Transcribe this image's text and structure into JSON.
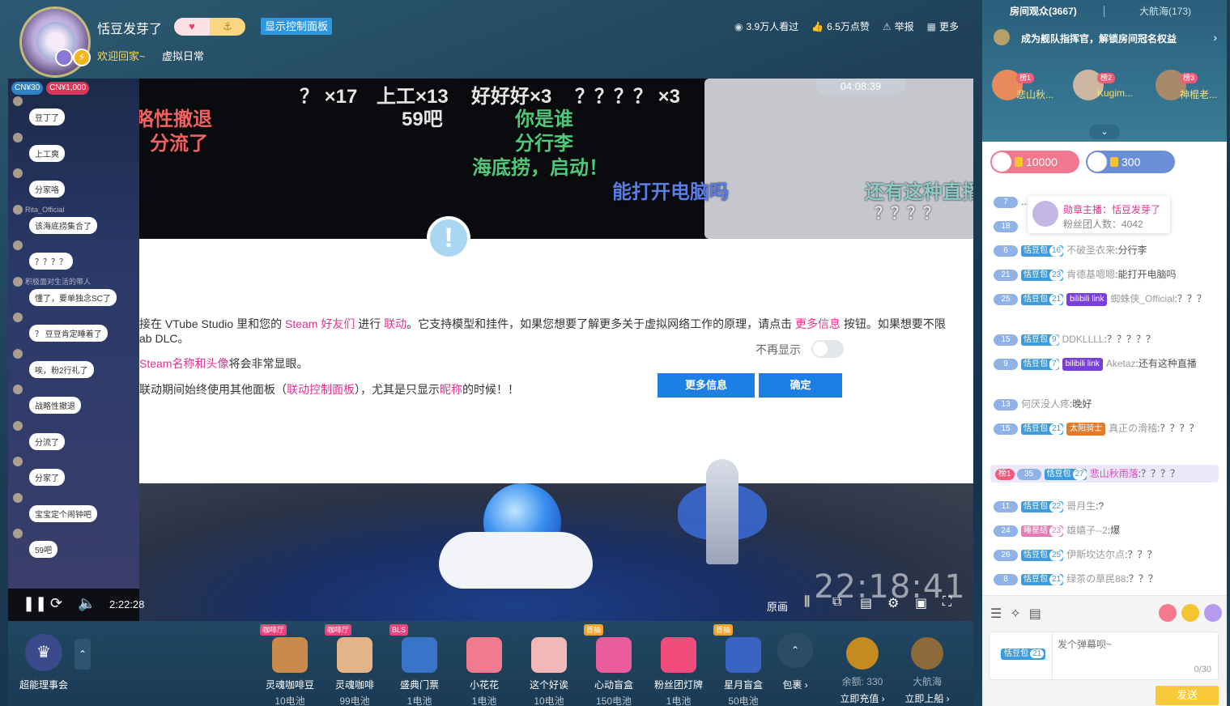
{
  "header": {
    "streamer_name": "恬豆发芽了",
    "control_panel_label": "显示控制面板",
    "welcome": "欢迎回家~",
    "area": "虚拟日常",
    "viewers": "3.9万人看过",
    "likes": "6.5万点赞",
    "report": "举报",
    "more": "更多"
  },
  "player": {
    "overlay_timer": "04:08:39",
    "danmaku": [
      {
        "text": "？ ×17",
        "color": "white"
      },
      {
        "text": "上工×13",
        "color": "white"
      },
      {
        "text": "好好好×3",
        "color": "white"
      },
      {
        "text": "？？？？ ×3",
        "color": "white"
      },
      {
        "text": "59吧",
        "color": "white"
      },
      {
        "text": "你是谁",
        "color": "green"
      },
      {
        "text": "战略性撤退",
        "color": "red"
      },
      {
        "text": "分流了",
        "color": "red"
      },
      {
        "text": "分行李",
        "color": "green"
      },
      {
        "text": "海底捞，启动！",
        "color": "green"
      },
      {
        "text": "能打开电脑吗",
        "color": "blue"
      },
      {
        "text": "还有这种直播",
        "color": "cyan"
      },
      {
        "text": "？？？？",
        "color": "white"
      }
    ],
    "dialog": {
      "p1_a": "接在 VTube Studio 里和您的 ",
      "p1_b": "Steam 好友们",
      "p1_c": " 进行 ",
      "p1_d": "联动",
      "p1_e": "。它支持模型和挂件，如果您想要了解更多关于虚拟网络工作的原理，请点击 ",
      "p1_f": "更多信息",
      "p1_g": " 按钮。如果想要不限",
      "p1_h": "ab DLC。",
      "p2_a": "Steam名称和头像",
      "p2_b": "将会非常显眼。",
      "p3_a": "联动期间始终使用其他面板（",
      "p3_b": "联动控制面板",
      "p3_c": "），尤其是只显示",
      "p3_d": "昵称",
      "p3_e": "的时候！！",
      "dont_show": "不再显示",
      "more_info": "更多信息",
      "confirm": "确定"
    },
    "stream_clock": "22:18:41",
    "play_time": "2:22:28",
    "quality": "原画",
    "in_chat": {
      "cn1": "CN¥30",
      "cn2": "CN¥1,000",
      "messages": [
        {
          "user": "",
          "text": "豆丁了"
        },
        {
          "user": "",
          "text": "上工爽"
        },
        {
          "user": "",
          "text": "分家咯"
        },
        {
          "user": "Rita_Official",
          "text": "该海底捞集合了"
        },
        {
          "user": "",
          "text": "？？？？"
        },
        {
          "user": "积极面对生活的带人",
          "text": "懂了，要单独念SC了"
        },
        {
          "user": "",
          "text": "？ 豆豆肯定睡着了"
        },
        {
          "user": "",
          "text": "唉，粉2行礼了"
        },
        {
          "user": "",
          "text": "战略性撤退"
        },
        {
          "user": "",
          "text": "分流了"
        },
        {
          "user": "",
          "text": "分家了"
        },
        {
          "user": "",
          "text": "宝宝定个闹钟吧"
        },
        {
          "user": "",
          "text": "59吧"
        }
      ]
    }
  },
  "giftbar": {
    "club_label": "超能理事会",
    "gifts": [
      {
        "tag": "咖啡厅",
        "name": "灵魂咖啡豆",
        "price": "10电池",
        "color": "#c98a4a"
      },
      {
        "tag": "咖啡厅",
        "name": "灵魂咖啡",
        "price": "99电池",
        "color": "#e2b487"
      },
      {
        "tag": "BLS",
        "name": "盛典门票",
        "price": "1电池",
        "color": "#3a74c9"
      },
      {
        "tag": "",
        "name": "小花花",
        "price": "1电池",
        "color": "#f07a8e"
      },
      {
        "tag": "",
        "name": "这个好诶",
        "price": "10电池",
        "color": "#f2b7b7"
      },
      {
        "tag": "首抽",
        "name": "心动盲盒",
        "price": "150电池",
        "color": "#e85d9a"
      },
      {
        "tag": "",
        "name": "粉丝团灯牌",
        "price": "1电池",
        "color": "#f04d7d"
      },
      {
        "tag": "首抽",
        "name": "星月盲盒",
        "price": "50电池",
        "color": "#3a64c4"
      }
    ],
    "package_label": "包裹",
    "balance_label": "余额: 330",
    "recharge_label": "立即充值",
    "voyage_label": "大航海",
    "board_label": "立即上船"
  },
  "sidebar": {
    "tab_viewers": "房间观众(3667)",
    "tab_voyage": "大航海(173)",
    "fleet_banner": "成为舰队指挥官，解锁房间冠名权益",
    "top_ranks": [
      {
        "rank": "榜1",
        "name": "悲山秋..."
      },
      {
        "rank": "榜2",
        "name": "Kugim..."
      },
      {
        "rank": "榜3",
        "name": "神棍老..."
      }
    ],
    "pill1_value": "10000",
    "pill2_value": "300",
    "anchor_card": {
      "title": "勋章主播：恬豆发芽了",
      "fans": "粉丝团人数：4042"
    },
    "messages": [
      {
        "lv": "7",
        "fan": "",
        "fan_lv": "",
        "medal": "",
        "user": "",
        "text": "...动!"
      },
      {
        "lv": "18",
        "fan": "",
        "fan_lv": "",
        "medal": "",
        "user": "",
        "text": ""
      },
      {
        "lv": "6",
        "fan": "恬豆包",
        "fan_lv": "16",
        "medal": "",
        "user": "不破圣衣来",
        "text": ":分行李"
      },
      {
        "lv": "21",
        "fan": "恬豆包",
        "fan_lv": "23",
        "medal": "",
        "user": "肯德基嗯嗯",
        "text": ":能打开电脑吗"
      },
      {
        "lv": "25",
        "fan": "恬豆包",
        "fan_lv": "21",
        "medal": "bilibili link",
        "user": "蜘蛛侠_Official",
        "text": ":？？？"
      },
      {
        "lv": "15",
        "fan": "恬豆包",
        "fan_lv": "9",
        "medal": "",
        "user": "DDKLLLL",
        "text": ":？？？？？"
      },
      {
        "lv": "9",
        "fan": "恬豆包",
        "fan_lv": "7",
        "medal": "bilibili link",
        "user": "Aketaz",
        "text": ":还有这种直播"
      },
      {
        "lv": "13",
        "fan": "",
        "fan_lv": "",
        "medal": "",
        "user": "何厌没人疼",
        "text": ":晚好"
      },
      {
        "lv": "15",
        "fan": "恬豆包",
        "fan_lv": "21",
        "medal": "太阳骑士",
        "user": "真正の滑稽",
        "text": ":？？？？"
      },
      {
        "lv": "35",
        "fan": "恬豆包",
        "fan_lv": "27",
        "medal": "",
        "user": "悲山秋雨落",
        "text": ":？？？？",
        "rank": "榜1"
      },
      {
        "lv": "11",
        "fan": "恬豆包",
        "fan_lv": "22",
        "medal": "",
        "user": "哥月生",
        "text": ":?"
      },
      {
        "lv": "24",
        "fan": "睡星结",
        "fan_lv": "23",
        "medal": "",
        "user": "雄嬉子--2",
        "text": ":爆"
      },
      {
        "lv": "26",
        "fan": "恬豆包",
        "fan_lv": "25",
        "medal": "",
        "user": "伊斯坎达尔点",
        "text": ":？？？"
      },
      {
        "lv": "8",
        "fan": "恬豆包",
        "fan_lv": "21",
        "medal": "",
        "user": "绿茶の草民88",
        "text": ":？？？"
      }
    ],
    "input": {
      "fan_badge": "恬豆包",
      "fan_badge_lv": "21",
      "placeholder": "发个弹幕呗~",
      "count": "0/30",
      "send": "发送"
    }
  }
}
